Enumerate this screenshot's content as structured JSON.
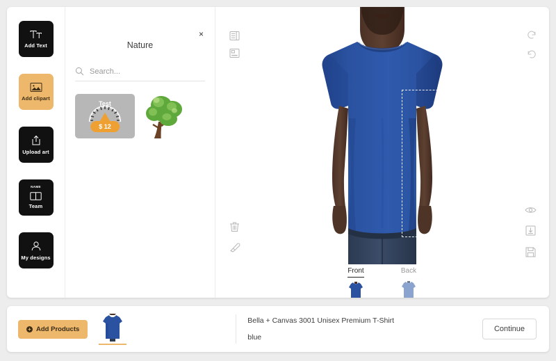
{
  "tool_rail": {
    "items": [
      {
        "label": "Add Text",
        "icon": "text-icon",
        "active": false
      },
      {
        "label": "Add clipart",
        "icon": "image-icon",
        "active": true
      },
      {
        "label": "Upload art",
        "icon": "upload-icon",
        "active": false
      },
      {
        "label": "Team",
        "icon": "team-jersey-icon",
        "badge": "NAME",
        "active": false
      },
      {
        "label": "My designs",
        "icon": "user-icon",
        "active": false
      }
    ]
  },
  "clipart_panel": {
    "title": "Nature",
    "close_label": "×",
    "search": {
      "value": "",
      "placeholder": "Search..."
    },
    "items": [
      {
        "name": "gauge-clipart",
        "label": "Test",
        "price": "$ 12",
        "paid": true
      },
      {
        "name": "tree-clipart",
        "label": "",
        "price": "",
        "paid": false
      }
    ]
  },
  "canvas": {
    "tools_left": [
      {
        "name": "layers-icon",
        "title": "Layers"
      },
      {
        "name": "align-icon",
        "title": "Align"
      }
    ],
    "tools_left_bottom": [
      {
        "name": "trash-icon",
        "title": "Delete"
      },
      {
        "name": "eraser-icon",
        "title": "Erase"
      }
    ],
    "tools_right": [
      {
        "name": "undo-icon",
        "title": "Undo"
      },
      {
        "name": "redo-icon",
        "title": "Redo"
      }
    ],
    "tools_right_bottom": [
      {
        "name": "preview-eye-icon",
        "title": "Preview"
      },
      {
        "name": "download-icon",
        "title": "Download"
      },
      {
        "name": "save-icon",
        "title": "Save"
      }
    ],
    "shirt_color_hex": "#2a52a0",
    "print_area_label": ""
  },
  "side_tabs": [
    {
      "label": "Front",
      "active": true
    },
    {
      "label": "Back",
      "active": false
    }
  ],
  "bottom_bar": {
    "add_products_label": "Add Products",
    "add_products_icon": "plus-circle-icon",
    "product_name": "Bella + Canvas 3001 Unisex Premium T-Shirt",
    "product_color": "blue",
    "continue_label": "Continue"
  },
  "colors": {
    "accent": "#edb76c",
    "dark": "#111111",
    "shirt_blue": "#2a52a0",
    "price_orange": "#efa033"
  }
}
